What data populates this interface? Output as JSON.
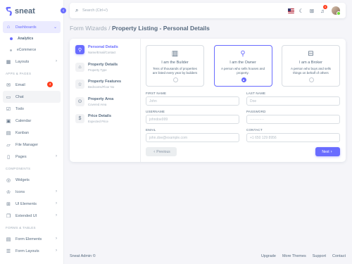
{
  "brand": {
    "name": "sneat",
    "accent": "#696cff"
  },
  "sidebar": {
    "items": [
      {
        "label": "Dashboards",
        "icon": "home-icon"
      },
      {
        "label": "Analytics"
      },
      {
        "label": "eCommerce"
      },
      {
        "label": "Layouts",
        "icon": "layout-icon"
      },
      {
        "label": "Email",
        "icon": "mail-icon",
        "badge": "4"
      },
      {
        "label": "Chat",
        "icon": "chat-icon"
      },
      {
        "label": "Todo",
        "icon": "check-icon"
      },
      {
        "label": "Calendar",
        "icon": "calendar-icon"
      },
      {
        "label": "Kanban",
        "icon": "kanban-icon"
      },
      {
        "label": "File Manager",
        "icon": "folder-icon"
      },
      {
        "label": "Pages",
        "icon": "file-icon"
      },
      {
        "label": "Widgets",
        "icon": "widget-icon"
      },
      {
        "label": "Icons",
        "icon": "crown-icon"
      },
      {
        "label": "UI Elements",
        "icon": "grid-icon"
      },
      {
        "label": "Extended UI",
        "icon": "copy-icon"
      },
      {
        "label": "Form Elements",
        "icon": "form-icon"
      },
      {
        "label": "Form Layouts",
        "icon": "list-icon"
      }
    ],
    "headers": [
      "APPS & PAGES",
      "COMPONENTS",
      "FORMS & TABLES"
    ]
  },
  "navbar": {
    "search_placeholder": "Search (Ctrl+/)",
    "notification_count": "4"
  },
  "page": {
    "breadcrumb": "Form Wizards /",
    "title": "Property Listing - Personal Details"
  },
  "wizard": {
    "steps": [
      {
        "title": "Personal Details",
        "subtitle": "Name/Email/Contact"
      },
      {
        "title": "Property Details",
        "subtitle": "Property Type"
      },
      {
        "title": "Property Features",
        "subtitle": "Bedrooms/Floor No"
      },
      {
        "title": "Property Area",
        "subtitle": "Covered Area"
      },
      {
        "title": "Price Details",
        "subtitle": "Expected Price"
      }
    ],
    "choices": [
      {
        "title": "I am the Builder",
        "desc": "Tens of thousands of properties are listed every year by builders"
      },
      {
        "title": "I am the Owner",
        "desc": "A person who sells houses and property."
      },
      {
        "title": "I am a Broker",
        "desc": "A person who buys and sells things on behalf of others"
      }
    ],
    "selected_choice": "I am the Owner",
    "fields": {
      "first_name": {
        "label": "FIRST NAME",
        "placeholder": "John"
      },
      "last_name": {
        "label": "LAST NAME",
        "placeholder": "Doe"
      },
      "username": {
        "label": "USERNAME",
        "placeholder": "johndoe999"
      },
      "password": {
        "label": "PASSWORD",
        "placeholder": "············"
      },
      "email": {
        "label": "EMAIL",
        "placeholder": "john.doe@example.com"
      },
      "contact": {
        "label": "CONTACT",
        "placeholder": "+1 650 129 8956"
      }
    },
    "prev_label": "Previous",
    "next_label": "Next"
  },
  "footer": {
    "brand": "Sneat Admin ©",
    "links": [
      "Upgrade",
      "More Themes",
      "Support",
      "Contact"
    ]
  }
}
